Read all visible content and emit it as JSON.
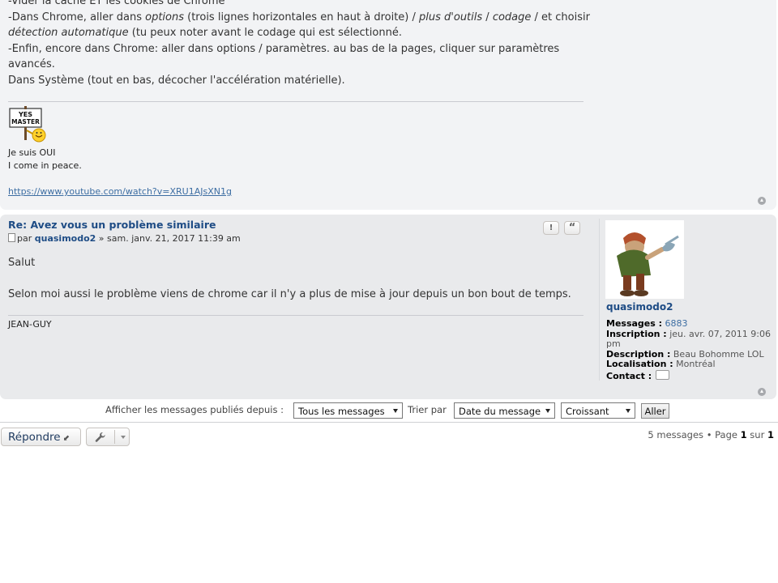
{
  "post1": {
    "partial_line": "-Vider la cache ET les cookies de Chrome",
    "line1_a": "-Dans Chrome, aller dans ",
    "line1_opt": "options",
    "line1_b": " (trois lignes horizontales en haut à droite) / ",
    "line1_tools": "plus d'outils",
    "line1_sep": " / ",
    "line1_codage": "codage",
    "line1_c": " / et choisir",
    "line2_auto": "détection automatique",
    "line2_rest": " (tu peux noter avant le codage qui est sélectionné.",
    "line3": "-Enfin, encore dans Chrome: aller dans options / paramètres. au bas de la pages, cliquer sur paramètres avancés.",
    "line4": "Dans Système (tout en bas, décocher l'accélération matérielle).",
    "sign_image_text_1": "YES",
    "sign_image_text_2": "MASTER",
    "sig_line1": "Je suis OUI",
    "sig_line2": "I come in peace.",
    "sig_link": "https://www.youtube.com/watch?v=XRU1AJsXN1g"
  },
  "post2": {
    "title": "Re: Avez vous un problème similaire",
    "meta_by": "par ",
    "meta_author": "quasimodo2",
    "meta_date": " » sam. janv. 21, 2017 11:39 am",
    "body_line1": "Salut",
    "body_line2": "Selon moi aussi le problème viens de chrome car il n'y a plus de mise à jour depuis un bon bout de temps.",
    "signature": "JEAN-GUY",
    "report_btn": "!",
    "quote_btn": "“"
  },
  "profile": {
    "username": "quasimodo2",
    "messages_label": "Messages :",
    "messages_value": "6883",
    "inscription_label": "Inscription :",
    "inscription_value": "jeu. avr. 07, 2011 9:06 pm",
    "description_label": "Description :",
    "description_value": "Beau Bohomme LOL",
    "localisation_label": "Localisation :",
    "localisation_value": "Montréal",
    "contact_label": "Contact :"
  },
  "filters": {
    "display_label": "Afficher les messages publiés depuis :",
    "display_value": "Tous les messages",
    "sort_label": "Trier par",
    "sort_value": "Date du message",
    "order_value": "Croissant",
    "go_label": "Aller"
  },
  "bottom": {
    "reply_label": "Répondre",
    "pagination_a": "5 messages • Page ",
    "pagination_page": "1",
    "pagination_b": " sur ",
    "pagination_total": "1"
  },
  "icons": {
    "back_to_top": "arrow-up-circle-icon",
    "reply_arrow": "reply-arrow-icon",
    "tools": "wrench-icon",
    "contact": "contact-icon",
    "post": "document-icon"
  },
  "colors": {
    "post_bg_1": "#f2f3f5",
    "post_bg_2": "#e9eaec",
    "link_blue": "#1e4c85"
  }
}
